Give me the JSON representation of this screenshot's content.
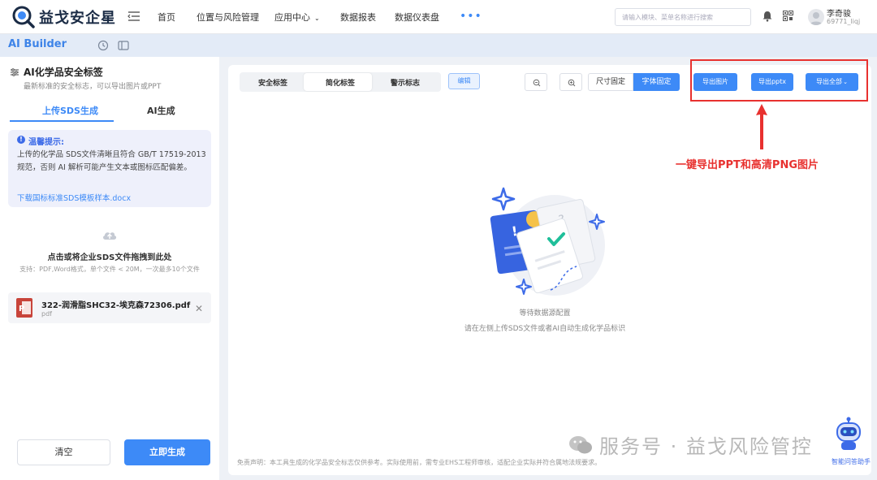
{
  "app": {
    "brand": "益戈安企星",
    "nav": [
      "首页",
      "位置与风险管理",
      "应用中心",
      "数据报表",
      "数据仪表盘"
    ],
    "nav_more": "•••",
    "search_placeholder": "请输入模块、菜单名称进行搜索",
    "user": {
      "name": "李奇骏",
      "id": "69771_liqj"
    }
  },
  "subheader": {
    "title": "AI Builder"
  },
  "left": {
    "title": "AI化学品安全标签",
    "subtitle": "最新标准的安全标志，可以导出图片或PPT",
    "tabs": [
      "上传SDS生成",
      "AI生成"
    ],
    "tip": {
      "title": "温馨提示:",
      "text": "上传的化学品 SDS文件清晰且符合 GB/T 17519-2013 规范，否则 AI 解析可能产生文本或图标匹配偏差。",
      "link": "下载国标标准SDS模板样本.docx"
    },
    "upload": {
      "title": "点击或将企业SDS文件拖拽到此处",
      "hint": "支持：PDF,Word格式，单个文件 < 20M，一次最多10个文件"
    },
    "file": {
      "name": "322-润滑脂SHC32-埃克森72306.pdf",
      "type": "pdf"
    },
    "buttons": {
      "clear": "清空",
      "generate": "立即生成"
    }
  },
  "main": {
    "segments": [
      "安全标签",
      "简化标签",
      "警示标志"
    ],
    "edit": "编辑",
    "size_fixed": "尺寸固定",
    "font_fixed": "字体固定",
    "exports": [
      "导出图片",
      "导出pptx",
      "导出全部"
    ],
    "annotation": "一键导出PPT和高清PNG图片",
    "empty_title": "等待数据源配置",
    "empty_hint": "请在左侧上传SDS文件或者AI自动生成化学品标识",
    "disclaimer": "免责声明：本工具生成的化学品安全标志仅供参考。实际使用前，需专业EHS工程师审核，适配企业实际并符合属地法规要求。"
  },
  "overlay": {
    "watermark": "服务号 · 益戈风险管控",
    "assistant": "智能问答助手"
  },
  "colors": {
    "accent": "#3d8af7",
    "annotation": "#e8312f",
    "brand_dark": "#1a2b45"
  }
}
